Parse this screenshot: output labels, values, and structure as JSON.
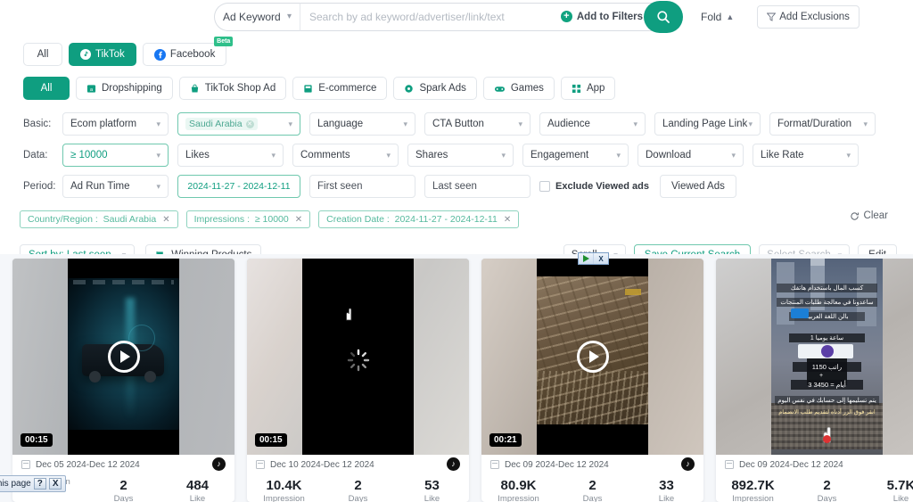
{
  "search": {
    "keyword_type": "Ad Keyword",
    "placeholder": "Search by ad keyword/advertiser/link/text",
    "value": "",
    "add_to_filters": "Add to Filters",
    "search_icon": "search-icon",
    "fold_label": "Fold",
    "add_exclusions": "Add Exclusions"
  },
  "platforms": [
    {
      "label": "All",
      "active": false,
      "icon": ""
    },
    {
      "label": "TikTok",
      "active": true,
      "icon": "tiktok-icon"
    },
    {
      "label": "Facebook",
      "active": false,
      "icon": "facebook-icon",
      "badge": "Beta"
    }
  ],
  "categories": [
    {
      "label": "All",
      "active": true,
      "icon": ""
    },
    {
      "label": "Dropshipping",
      "active": false,
      "icon": "box-icon"
    },
    {
      "label": "TikTok Shop Ad",
      "active": false,
      "icon": "bag-icon"
    },
    {
      "label": "E-commerce",
      "active": false,
      "icon": "store-icon"
    },
    {
      "label": "Spark Ads",
      "active": false,
      "icon": "spark-icon"
    },
    {
      "label": "Games",
      "active": false,
      "icon": "gamepad-icon"
    },
    {
      "label": "App",
      "active": false,
      "icon": "grid-icon"
    }
  ],
  "filters": {
    "basic": {
      "label": "Basic:",
      "items": [
        {
          "label": "Ecom platform",
          "type": "select",
          "selected": false
        },
        {
          "label": "Saudi Arabia",
          "type": "tag-select",
          "selected": true
        },
        {
          "label": "Language",
          "type": "select",
          "selected": false
        },
        {
          "label": "CTA Button",
          "type": "select",
          "selected": false
        },
        {
          "label": "Audience",
          "type": "select",
          "selected": false
        },
        {
          "label": "Landing Page Link",
          "type": "select",
          "selected": false
        },
        {
          "label": "Format/Duration",
          "type": "select",
          "selected": false
        }
      ]
    },
    "data": {
      "label": "Data:",
      "items": [
        {
          "label": "≥ 10000",
          "type": "select",
          "selected": true
        },
        {
          "label": "Likes",
          "type": "select",
          "selected": false
        },
        {
          "label": "Comments",
          "type": "select",
          "selected": false
        },
        {
          "label": "Shares",
          "type": "select",
          "selected": false
        },
        {
          "label": "Engagement",
          "type": "select",
          "selected": false
        },
        {
          "label": "Download",
          "type": "select",
          "selected": false
        },
        {
          "label": "Like Rate",
          "type": "select",
          "selected": false
        }
      ]
    },
    "period": {
      "label": "Period:",
      "run_time": "Ad Run Time",
      "date_range": "2024-11-27 - 2024-12-11",
      "first_seen": "First seen",
      "last_seen": "Last seen",
      "exclude_viewed": "Exclude Viewed ads",
      "exclude_viewed_checked": false,
      "viewed_ads": "Viewed Ads"
    }
  },
  "chips": [
    {
      "key": "Country/Region",
      "value": "Saudi Arabia"
    },
    {
      "key": "Impressions",
      "value": "≥ 10000"
    },
    {
      "key": "Creation Date",
      "value": "2024-11-27 - 2024-12-11"
    }
  ],
  "clear_label": "Clear",
  "sortbar": {
    "sort_by": "Sort by: Last seen",
    "winning_products": "Winning Products",
    "scroll": "Scroll",
    "save_current_search": "Save Current Search",
    "select_search_placeholder": "Select Search",
    "edit": "Edit"
  },
  "cards": [
    {
      "duration": "00:15",
      "dates": "Dec 05 2024-Dec 12 2024",
      "platform_icon": "tiktok-icon",
      "stats": [
        {
          "value": "",
          "key": "Impression"
        },
        {
          "value": "2",
          "key": "Days"
        },
        {
          "value": "484",
          "key": "Like"
        }
      ],
      "state": "loaded",
      "theme": "car"
    },
    {
      "duration": "00:15",
      "dates": "Dec 10 2024-Dec 12 2024",
      "platform_icon": "tiktok-icon",
      "stats": [
        {
          "value": "10.4K",
          "key": "Impression"
        },
        {
          "value": "2",
          "key": "Days"
        },
        {
          "value": "53",
          "key": "Like"
        }
      ],
      "state": "loading",
      "theme": "blank"
    },
    {
      "duration": "00:21",
      "dates": "Dec 09 2024-Dec 12 2024",
      "platform_icon": "tiktok-icon",
      "stats": [
        {
          "value": "80.9K",
          "key": "Impression"
        },
        {
          "value": "2",
          "key": "Days"
        },
        {
          "value": "33",
          "key": "Like"
        }
      ],
      "state": "loaded",
      "theme": "nest"
    },
    {
      "duration": "",
      "dates": "Dec 09 2024-Dec 12 2024",
      "platform_icon": "tiktok-icon",
      "stats": [
        {
          "value": "892.7K",
          "key": "Impression"
        },
        {
          "value": "2",
          "key": "Days"
        },
        {
          "value": "5.7K",
          "key": "Like"
        }
      ],
      "state": "loaded",
      "theme": "mecca",
      "overlay_text": [
        "كسب المال باستخدام هاتفك",
        "ساعدونا في معالجة طلبات المنتجات",
        "بالن اللغة العربية",
        "1 ساعة يوميا",
        "راتب 1150",
        "3 أيام = 3450",
        "يتم تسليمها إلى حسابك في نفس اليوم",
        "انقر فوق الزر أدناه لتقديم طلب الانضمام"
      ]
    }
  ],
  "browser_notice": {
    "text": "m this page",
    "help": "?",
    "close": "X"
  },
  "ad_overlay": {
    "close": "X"
  },
  "colors": {
    "accent": "#0f9e80",
    "accent_light": "#6fc8ae",
    "page_bg": "#f5f7fa",
    "text": "#2b2f38",
    "muted": "#868d96"
  }
}
